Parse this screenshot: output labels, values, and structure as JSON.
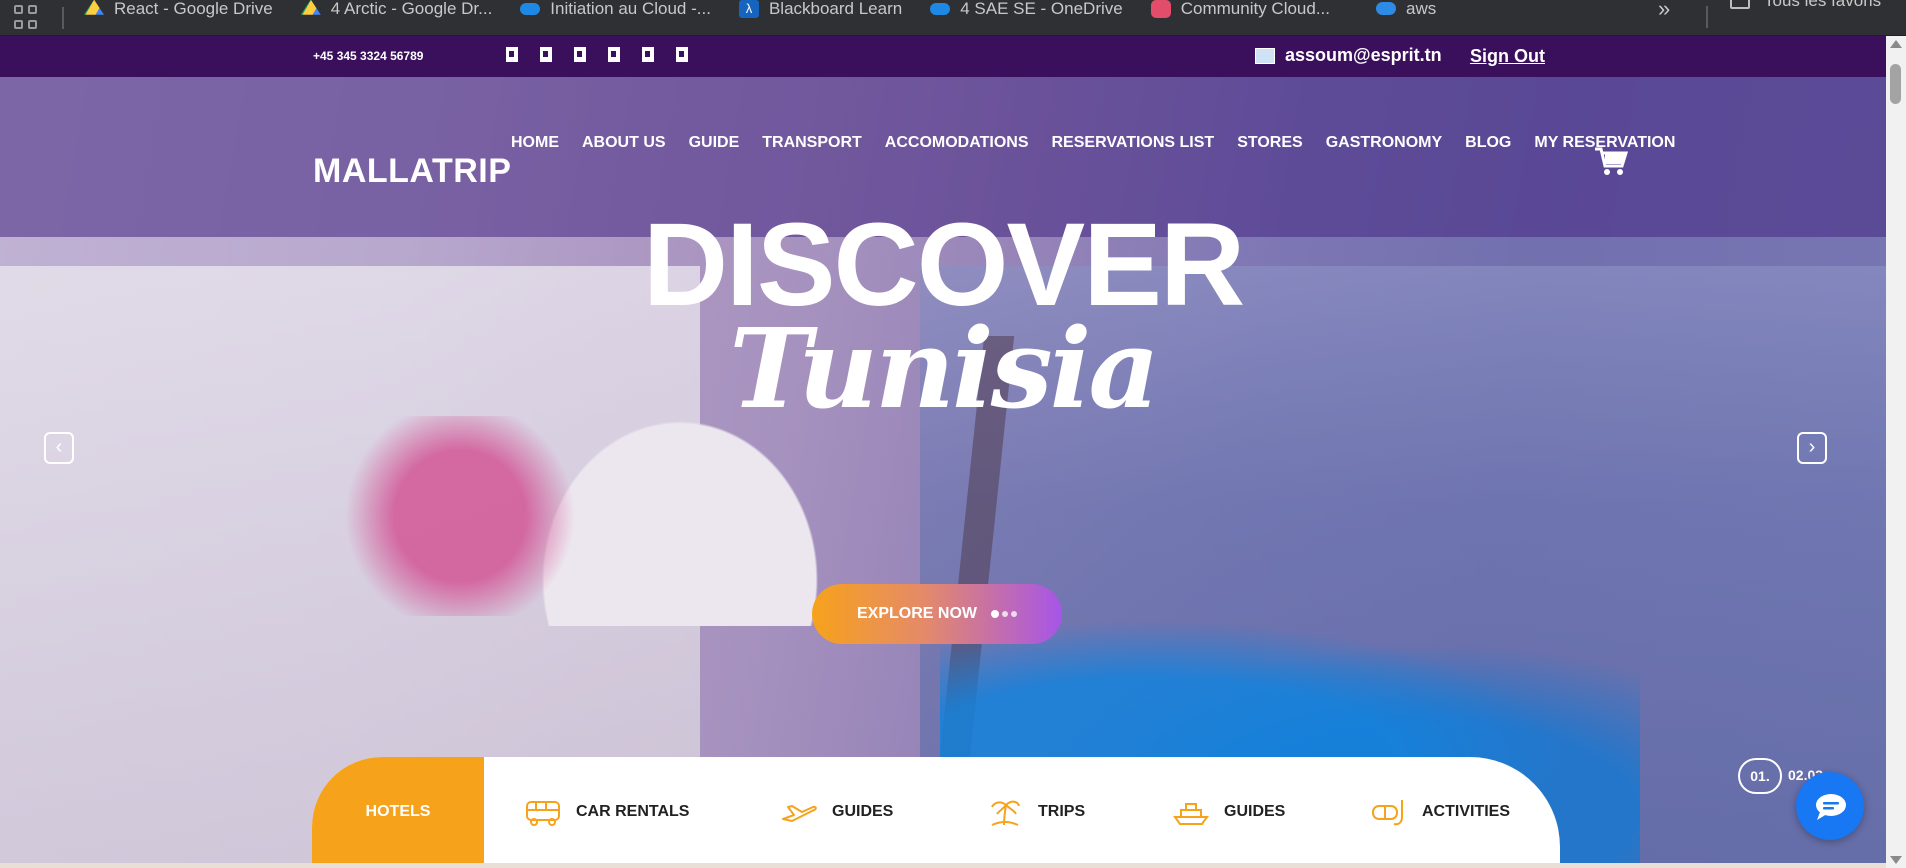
{
  "browser": {
    "bookmarks": [
      {
        "label": "React - Google Drive",
        "icon": "google-drive-icon"
      },
      {
        "label": "4 Arctic - Google Dr...",
        "icon": "google-drive-icon"
      },
      {
        "label": "Initiation au Cloud -...",
        "icon": "onedrive-icon"
      },
      {
        "label": "Blackboard Learn",
        "icon": "blackboard-icon",
        "glyph": "λ"
      },
      {
        "label": "4 SAE SE - OneDrive",
        "icon": "onedrive-icon"
      },
      {
        "label": "Community Cloud...",
        "icon": "community-icon"
      },
      {
        "label": "aws",
        "icon": "aws-cloud-icon"
      }
    ],
    "more_glyph": "»",
    "all_bookmarks_label": "Tous les favoris"
  },
  "topbar": {
    "phone": "+45 345 3324 56789",
    "social_icons": [
      "facebook-icon",
      "twitter-icon",
      "instagram-icon",
      "linkedin-icon",
      "youtube-icon",
      "pinterest-icon"
    ],
    "user_email": "assoum@esprit.tn",
    "signout_label": "Sign Out"
  },
  "header": {
    "logo": "MALLATRIP",
    "nav": [
      "HOME",
      "ABOUT US",
      "GUIDE",
      "TRANSPORT",
      "ACCOMODATIONS",
      "RESERVATIONS LIST",
      "STORES",
      "GASTRONOMY",
      "BLOG",
      "MY RESERVATION"
    ]
  },
  "hero": {
    "title": "DISCOVER",
    "subtitle": "Tunisia",
    "prev_glyph": "‹",
    "next_glyph": "›",
    "cta_label": "EXPLORE NOW"
  },
  "categories": [
    {
      "label": "HOTELS",
      "icon": "hotel-icon",
      "active": true
    },
    {
      "label": "CAR RENTALS",
      "icon": "bus-icon",
      "active": false
    },
    {
      "label": "GUIDES",
      "icon": "airplane-icon",
      "active": false
    },
    {
      "label": "TRIPS",
      "icon": "palm-island-icon",
      "active": false
    },
    {
      "label": "GUIDES",
      "icon": "ship-icon",
      "active": false
    },
    {
      "label": "ACTIVITIES",
      "icon": "diving-mask-icon",
      "active": false
    }
  ],
  "slider": {
    "current": "01.",
    "next": "02.03"
  },
  "colors": {
    "topbar": "#3a0f5c",
    "accent_orange": "#f7a21b",
    "accent_purple": "#a655e8",
    "chat_blue": "#1877f2"
  }
}
